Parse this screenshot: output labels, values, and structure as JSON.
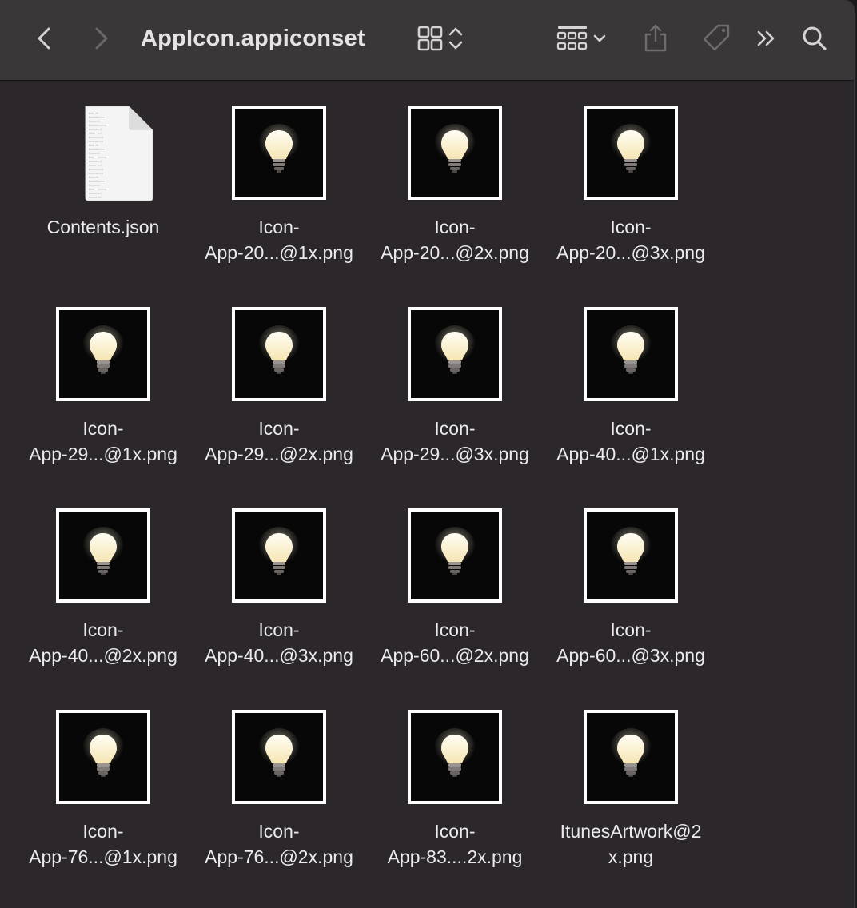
{
  "window": {
    "title": "AppIcon.appiconset"
  },
  "toolbar": {
    "back_icon": "chevron-left-icon",
    "forward_icon": "chevron-right-icon",
    "view_icon": "icon-grid-view-icon",
    "view_toggle_icon": "up-down-chevrons-icon",
    "group_icon": "group-by-icon",
    "group_menu_icon": "chevron-down-icon",
    "share_icon": "share-icon",
    "tag_icon": "tag-icon",
    "more_icon": "double-chevron-right-icon",
    "search_icon": "magnifier-icon"
  },
  "files": [
    {
      "type": "document",
      "line1": "Contents.json",
      "line2": ""
    },
    {
      "type": "image",
      "pixelated": true,
      "line1": "Icon-",
      "line2": "App-20...@1x.png"
    },
    {
      "type": "image",
      "line1": "Icon-",
      "line2": "App-20...@2x.png"
    },
    {
      "type": "image",
      "line1": "Icon-",
      "line2": "App-20...@3x.png"
    },
    {
      "type": "image",
      "pixelated": true,
      "line1": "Icon-",
      "line2": "App-29...@1x.png"
    },
    {
      "type": "image",
      "line1": "Icon-",
      "line2": "App-29...@2x.png"
    },
    {
      "type": "image",
      "line1": "Icon-",
      "line2": "App-29...@3x.png"
    },
    {
      "type": "image",
      "line1": "Icon-",
      "line2": "App-40...@1x.png"
    },
    {
      "type": "image",
      "line1": "Icon-",
      "line2": "App-40...@2x.png"
    },
    {
      "type": "image",
      "line1": "Icon-",
      "line2": "App-40...@3x.png"
    },
    {
      "type": "image",
      "line1": "Icon-",
      "line2": "App-60...@2x.png"
    },
    {
      "type": "image",
      "line1": "Icon-",
      "line2": "App-60...@3x.png"
    },
    {
      "type": "image",
      "line1": "Icon-",
      "line2": "App-76...@1x.png"
    },
    {
      "type": "image",
      "line1": "Icon-",
      "line2": "App-76...@2x.png"
    },
    {
      "type": "image",
      "line1": "Icon-",
      "line2": "App-83....2x.png"
    },
    {
      "type": "image",
      "line1": "ItunesArtwork@2",
      "line2": "x.png"
    }
  ],
  "colors": {
    "window_bg": "#2b272a",
    "toolbar_bg": "#3a3739",
    "thumb_border": "#ffffff",
    "thumb_bg": "#070707",
    "text": "#eceaec"
  }
}
